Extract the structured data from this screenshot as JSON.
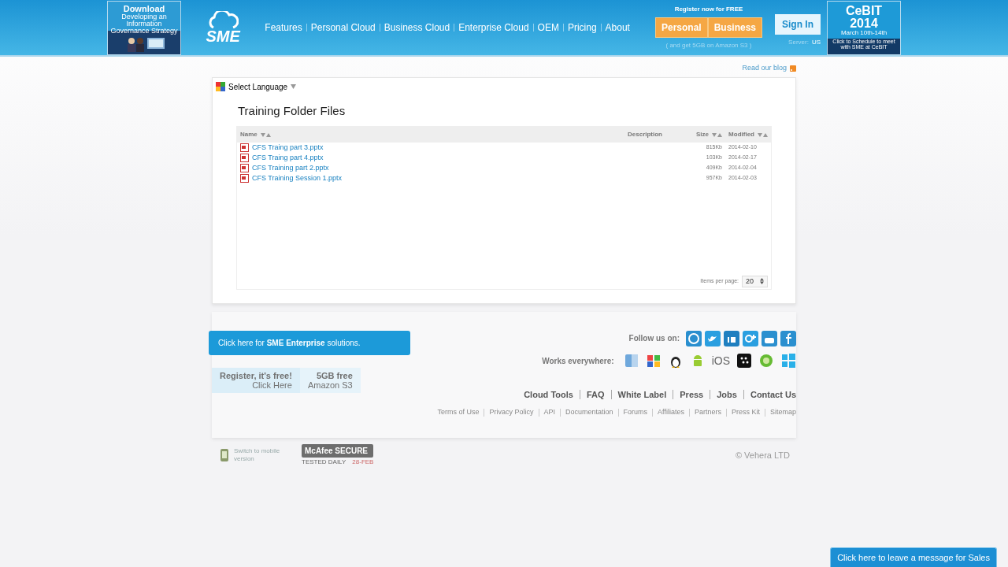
{
  "header": {
    "promo": {
      "title": "Download",
      "subtitle": "Developing an Information Governance Strategy"
    },
    "logo": "SME",
    "nav": [
      "Features",
      "Personal Cloud",
      "Business Cloud",
      "Enterprise Cloud",
      "OEM",
      "Pricing",
      "About"
    ],
    "register": {
      "caption": "Register now for FREE",
      "buttons": [
        "Personal",
        "Business"
      ],
      "note": "( and get 5GB on Amazon S3 )"
    },
    "sign_in": "Sign In",
    "server": {
      "label": "Server:",
      "value": "US"
    },
    "event_ad": {
      "title": "CeBIT",
      "year": "2014",
      "dates": "March 10th-14th",
      "cta": "Click to Schedule to meet with SME at CeBIT"
    }
  },
  "blog_link": "Read our blog",
  "language": "Select Language",
  "folder": {
    "title": "Training Folder Files",
    "columns": [
      "Name",
      "Description",
      "Size",
      "Modified"
    ],
    "rows": [
      {
        "name": "CFS Traing part 3.pptx",
        "size": "815Kb",
        "modified": "2014-02-10"
      },
      {
        "name": "CFS Traing part 4.pptx",
        "size": "103Kb",
        "modified": "2014-02-17"
      },
      {
        "name": "CFS Training part 2.pptx",
        "size": "409Kb",
        "modified": "2014-02-04"
      },
      {
        "name": "CFS Training Session 1.pptx",
        "size": "957Kb",
        "modified": "2014-02-03"
      }
    ],
    "items_per_page": {
      "label": "Items per page:",
      "value": "20"
    }
  },
  "enterprise_banner": "Click here for **SME Enterprise** solutions.",
  "register_box": [
    {
      "title": "Register, it's free!",
      "sub": "Click Here"
    },
    {
      "title": "5GB free",
      "sub": "Amazon S3"
    }
  ],
  "follow_label": "Follow us on:",
  "social": [
    {
      "kind": "wordpress",
      "color": "#2a8fcf"
    },
    {
      "kind": "twitter",
      "color": "#2a9fe0"
    },
    {
      "kind": "linkedin",
      "color": "#1f7fc0"
    },
    {
      "kind": "googleplus",
      "color": "#2a9fe0"
    },
    {
      "kind": "youtube",
      "color": "#2a8fcf"
    },
    {
      "kind": "facebook",
      "color": "#2a8fcf"
    }
  ],
  "platform_label": "Works everywhere:",
  "platforms": [
    {
      "kind": "mac"
    },
    {
      "kind": "windows"
    },
    {
      "kind": "linux"
    },
    {
      "kind": "android"
    },
    {
      "kind": "text",
      "label": "iOS"
    },
    {
      "kind": "blackberry"
    },
    {
      "kind": "symbian"
    },
    {
      "kind": "winphone"
    }
  ],
  "footer_main": [
    "Cloud Tools",
    "FAQ",
    "White Label",
    "Press",
    "Jobs",
    "Contact Us"
  ],
  "footer_small": [
    "Terms of Use",
    "Privacy Policy",
    "API",
    "Documentation",
    "Forums",
    "Affiliates",
    "Partners",
    "Press Kit",
    "Sitemap"
  ],
  "mobile_switch": "Switch to mobile version",
  "security_badge": {
    "title": "McAfee SECURE",
    "tested": "TESTED DAILY",
    "date": "28-FEB"
  },
  "copyright": "© Vehera LTD",
  "chat_tab": "Click here to leave a message for Sales"
}
